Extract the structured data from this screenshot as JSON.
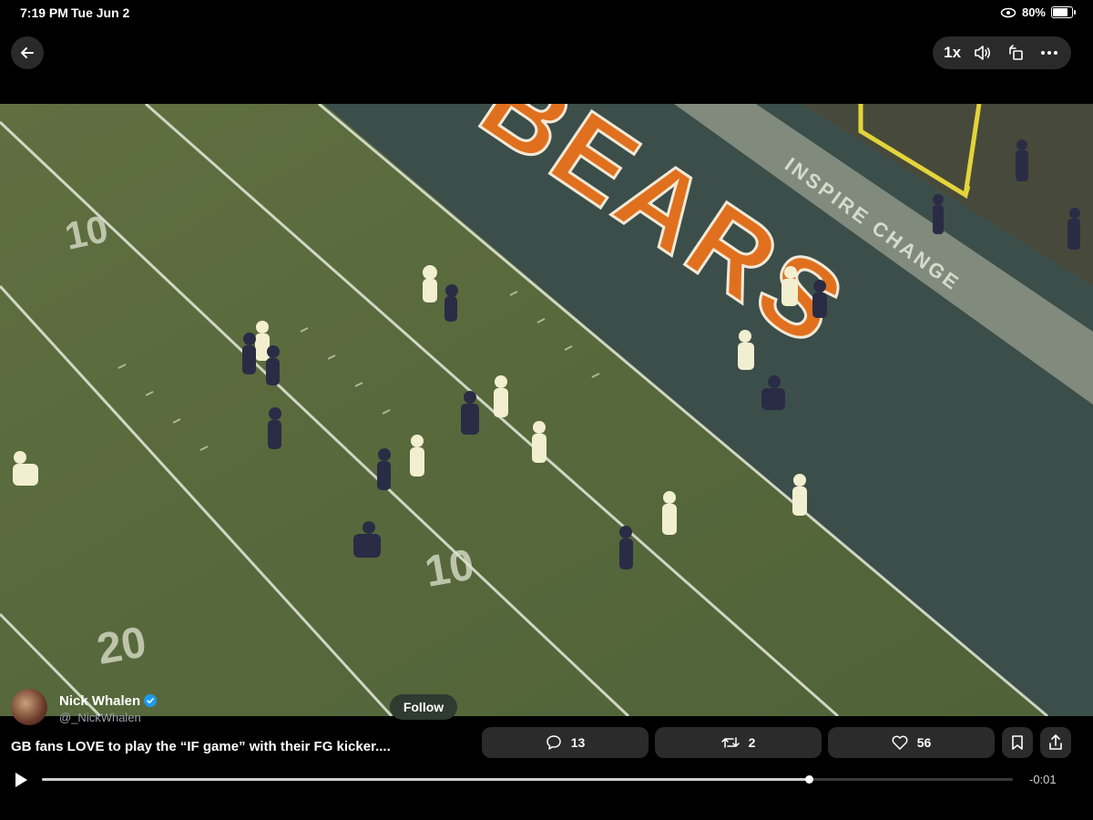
{
  "status_bar": {
    "time": "7:19 PM",
    "date": "Tue Jun 2",
    "battery": "80%",
    "battery_level": 0.8,
    "icons": [
      "link-icon",
      "battery-icon"
    ]
  },
  "toolbar": {
    "back_icon": "arrow-left-icon",
    "speed": "1x",
    "icons": [
      "volume-icon",
      "rotate-icon",
      "more-icon"
    ]
  },
  "video": {
    "field_text": {
      "endzone": "BEARS",
      "sideline": "INSPIRE CHANGE",
      "yard_10_top": "10",
      "yard_10": "10",
      "yard_20": "20"
    },
    "colors": {
      "turf": "#5c6b3f",
      "endzone": "#3c4e4a",
      "endzone_letters": "#e0701e",
      "lines": "#e8ecdc"
    }
  },
  "author": {
    "name": "Nick Whalen",
    "handle": "@_NickWhalen",
    "verified": true,
    "follow_label": "Follow"
  },
  "tweet": {
    "text": "GB fans LOVE to play the “IF game” with their FG kicker...."
  },
  "actions": {
    "replies": "13",
    "reposts": "2",
    "likes": "56",
    "icons": [
      "reply-icon",
      "repost-icon",
      "like-icon",
      "bookmark-icon",
      "share-icon"
    ]
  },
  "player": {
    "progress": 0.79,
    "time_remaining": "-0:01",
    "play_icon": "play-icon"
  }
}
